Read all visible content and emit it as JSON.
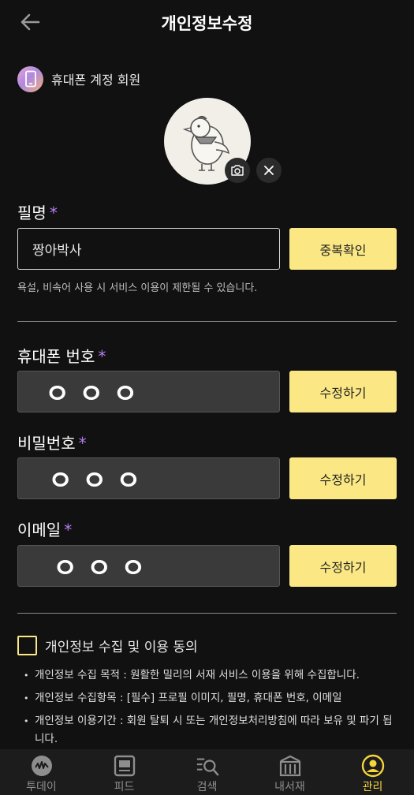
{
  "header": {
    "title": "개인정보수정"
  },
  "account": {
    "type_label": "휴대폰 계정 회원"
  },
  "nickname": {
    "label": "필명",
    "required_mark": "*",
    "value": "짱아박사",
    "check_button": "중복확인",
    "helper": "욕설, 비속어 사용 시 서비스 이용이 제한될 수 있습니다."
  },
  "phone": {
    "label": "휴대폰 번호",
    "required_mark": "*",
    "masked": "ㅇ ㅇ ㅇ",
    "edit_button": "수정하기"
  },
  "password": {
    "label": "비밀번호",
    "required_mark": "*",
    "masked": "ㅇ ㅇ ㅇ",
    "edit_button": "수정하기"
  },
  "email": {
    "label": "이메일",
    "required_mark": "*",
    "masked": "ㅇ ㅇ ㅇ",
    "edit_button": "수정하기"
  },
  "consent": {
    "label": "개인정보 수집 및 이용 동의",
    "checked": false,
    "notes": [
      "개인정보 수집 목적 : 원활한 밀리의 서재 서비스 이용을 위해 수집합니다.",
      "개인정보 수집항목 : [필수] 프로필 이미지, 필명, 휴대폰 번호, 이메일",
      "개인정보 이용기간 : 회원 탈퇴 시 또는 개인정보처리방침에 따라 보유 및 파기 됩니다."
    ]
  },
  "tabs": [
    {
      "label": "투데이",
      "icon": "today-icon",
      "active": false
    },
    {
      "label": "피드",
      "icon": "feed-icon",
      "active": false
    },
    {
      "label": "검색",
      "icon": "search-icon",
      "active": false
    },
    {
      "label": "내서재",
      "icon": "library-icon",
      "active": false
    },
    {
      "label": "관리",
      "icon": "profile-icon",
      "active": true
    }
  ],
  "colors": {
    "accent": "#fbe884",
    "required": "#b57cf0",
    "active_tab": "#f6d53c",
    "background": "#111111"
  }
}
